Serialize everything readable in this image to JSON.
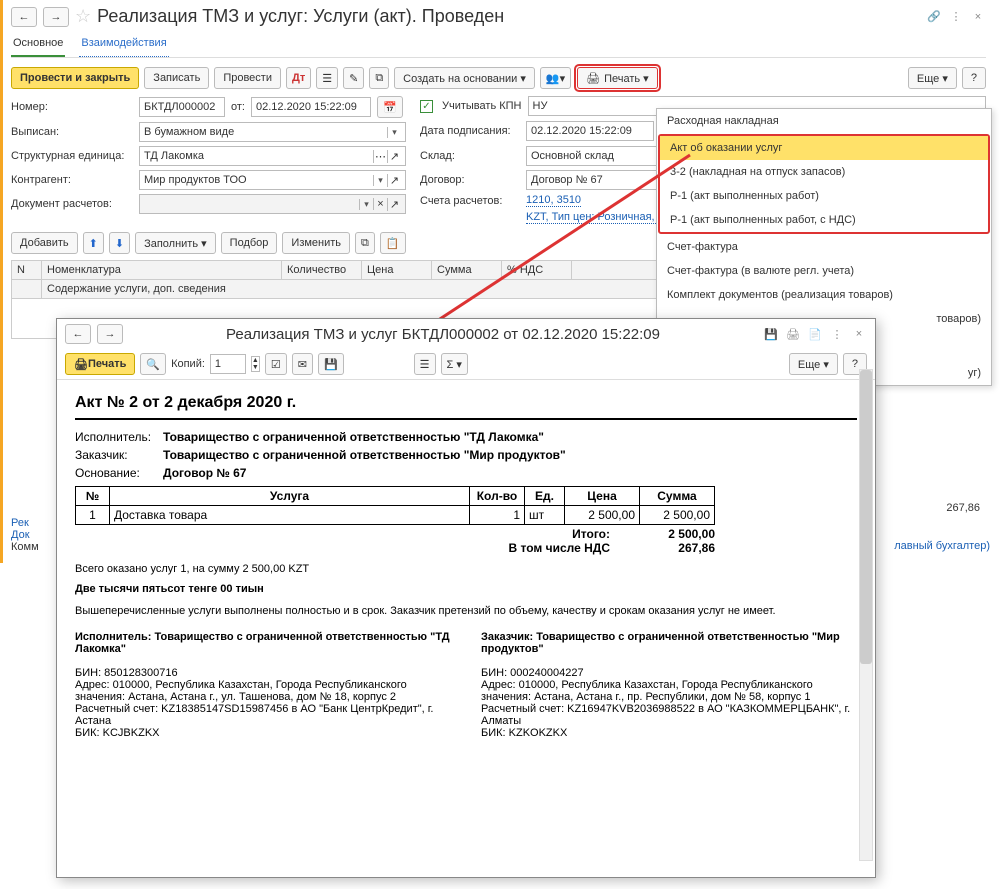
{
  "titlebar": {
    "title": "Реализация ТМЗ и услуг: Услуги (акт). Проведен",
    "back": "←",
    "fwd": "→",
    "star": "☆",
    "link": "🔗",
    "more": "⋮",
    "close": "×"
  },
  "tabs": {
    "main": "Основное",
    "interactions": "Взаимодействия"
  },
  "toolbar": {
    "post_close": "Провести и закрыть",
    "save": "Записать",
    "post": "Провести",
    "create_based": "Создать на основании ▾",
    "print": "Печать ▾",
    "more": "Еще ▾",
    "help": "?"
  },
  "form": {
    "number_lbl": "Номер:",
    "number": "БКТДЛ000002",
    "from": "от:",
    "date": "02.12.2020 15:22:09",
    "kpn_chk": "Учитывать КПН",
    "kpn_val": "НУ",
    "issued_lbl": "Выписан:",
    "issued": "В бумажном виде",
    "sign_lbl": "Дата подписания:",
    "sign": "02.12.2020 15:22:09",
    "unit_lbl": "Структурная единица:",
    "unit": "ТД Лакомка",
    "warehouse_lbl": "Склад:",
    "warehouse": "Основной склад",
    "counter_lbl": "Контрагент:",
    "counter": "Мир продуктов ТОО",
    "contract_lbl": "Договор:",
    "contract": "Договор № 67",
    "docpay_lbl": "Документ расчетов:",
    "acc_lbl": "Счета расчетов:",
    "acc": "1210, 3510",
    "pricetype": "KZT, Тип цен: Розничная, НДС (в т.ч.)"
  },
  "tabletb": {
    "add": "Добавить",
    "fill": "Заполнить ▾",
    "select": "Подбор",
    "edit": "Изменить"
  },
  "tablehdr": [
    "N",
    "Номенклатура",
    "Количество",
    "Цена",
    "Сумма",
    "% НДС"
  ],
  "tablehdr2": "Содержание услуги, доп. сведения",
  "bottom": {
    "rec": "Рек",
    "doc": "Док",
    "comm": "Комм",
    "acct": "лавный бухгалтер)",
    "sum": "267,86"
  },
  "printmenu": {
    "items_top": [
      "Расходная накладная"
    ],
    "items_hl": "Акт об оказании услуг",
    "items_group": [
      "3-2 (накладная на отпуск запасов)",
      "Р-1 (акт выполненных работ)",
      "Р-1 (акт выполненных работ, с НДС)"
    ],
    "items_rest": [
      "Счет-фактура",
      "Счет-фактура (в валюте регл. учета)",
      "Комплект документов (реализация товаров)"
    ],
    "items_cut1": "товаров)",
    "items_cut2": "уг)"
  },
  "sub": {
    "title": "Реализация ТМЗ и услуг БКТДЛ000002 от 02.12.2020 15:22:09",
    "print": "Печать",
    "copies_lbl": "Копий:",
    "copies": "1",
    "more": "Еще ▾",
    "help": "?",
    "akt_title": "Акт № 2 от 2 декабря 2020 г.",
    "exec_lbl": "Исполнитель:",
    "exec": "Товарищество с ограниченной ответственностью \"ТД Лакомка\"",
    "cust_lbl": "Заказчик:",
    "cust": "Товарищество с ограниченной ответственностью \"Мир продуктов\"",
    "base_lbl": "Основание:",
    "base": "Договор № 67",
    "thdr": [
      "№",
      "Услуга",
      "Кол-во",
      "Ед.",
      "Цена",
      "Сумма"
    ],
    "trow": [
      "1",
      "Доставка товара",
      "1",
      "шт",
      "2 500,00",
      "2 500,00"
    ],
    "total_lbl": "Итого:",
    "total": "2 500,00",
    "vat_lbl": "В том числе НДС",
    "vat": "267,86",
    "sumtext1": "Всего оказано услуг 1, на сумму 2 500,00 KZT",
    "sumtext2": "Две тысячи пятьсот тенге 00 тиын",
    "note": "Вышеперечисленные услуги выполнены полностью и в срок. Заказчик претензий по объему, качеству и срокам оказания услуг не имеет.",
    "col1_h": "Исполнитель: Товарищество с ограниченной ответственностью \"ТД Лакомка\"",
    "col1_1": "БИН: 850128300716",
    "col1_2": "Адрес: 010000, Республика Казахстан, Города Республиканского значения: Астана, Астана г., ул. Ташенова, дом № 18, корпус 2",
    "col1_3": "Расчетный счет: KZ18385147SD15987456 в АО \"Банк ЦентрКредит\", г. Астана",
    "col1_4": "БИК: KCJBKZKX",
    "col2_h": "Заказчик: Товарищество с ограниченной ответственностью \"Мир продуктов\"",
    "col2_1": "БИН: 000240004227",
    "col2_2": "Адрес: 010000, Республика Казахстан, Города Республиканского значения: Астана, Астана г., пр. Республики, дом № 58, корпус 1",
    "col2_3": "Расчетный счет: KZ16947KVB2036988522 в АО \"КАЗКОММЕРЦБАНК\", г. Алматы",
    "col2_4": "БИК: KZKOKZKX"
  }
}
